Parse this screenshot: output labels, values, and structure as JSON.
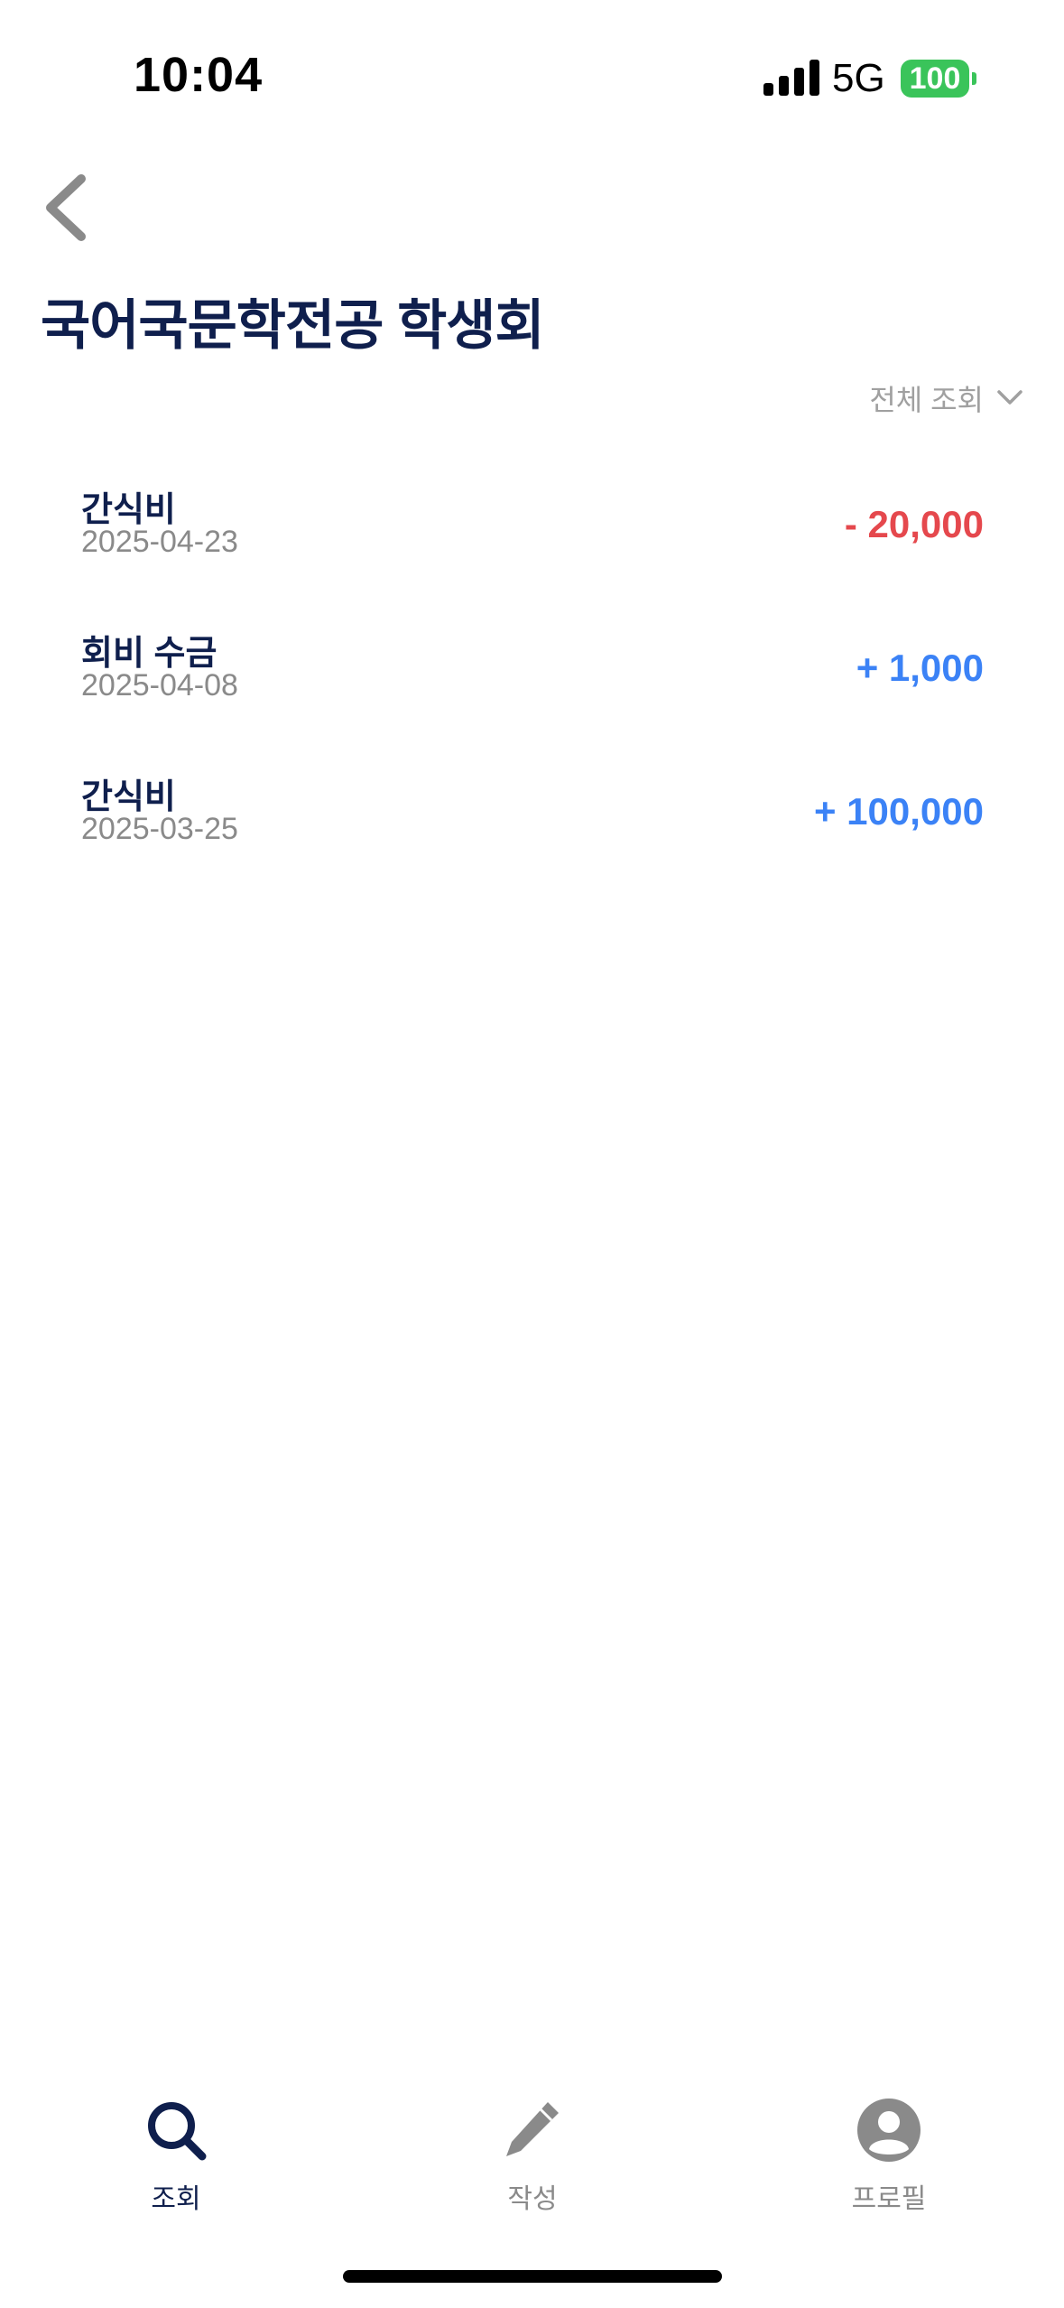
{
  "status_bar": {
    "time": "10:04",
    "network": "5G",
    "battery": "100",
    "battery_color": "#3ac45a"
  },
  "header": {
    "back_icon": "chevron-left-icon",
    "title": "국어국문학전공 학생회"
  },
  "filter": {
    "label": "전체 조회",
    "icon": "chevron-down-icon"
  },
  "transactions": [
    {
      "title": "간식비",
      "date": "2025-04-23",
      "amount": "- 20,000",
      "type": "expense"
    },
    {
      "title": "회비 수금",
      "date": "2025-04-08",
      "amount": "+ 1,000",
      "type": "income"
    },
    {
      "title": "간식비",
      "date": "2025-03-25",
      "amount": "+ 100,000",
      "type": "income"
    }
  ],
  "colors": {
    "title": "#0f1f4d",
    "expense": "#e5484d",
    "income": "#3b82f6",
    "muted": "#8a8a8a",
    "tab_active": "#0f1f4d",
    "tab_inactive": "#8a8a8a"
  },
  "tabs": [
    {
      "label": "조회",
      "icon": "search-icon",
      "active": true
    },
    {
      "label": "작성",
      "icon": "pencil-icon",
      "active": false
    },
    {
      "label": "프로필",
      "icon": "profile-icon",
      "active": false
    }
  ]
}
